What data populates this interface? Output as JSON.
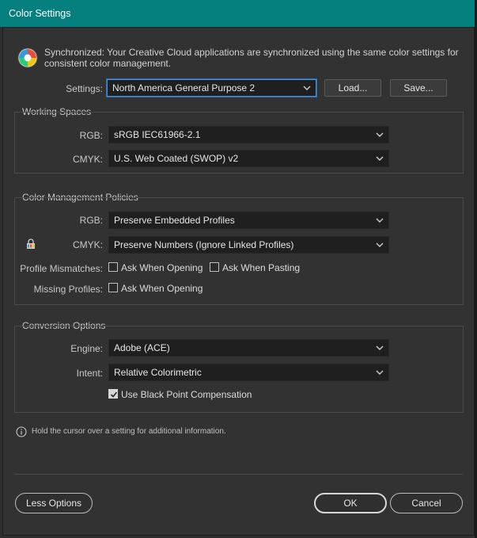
{
  "window": {
    "title": "Color Settings"
  },
  "sync": {
    "icon": "color-wheel-icon",
    "message": "Synchronized: Your Creative Cloud applications are synchronized using the same color settings for consistent color management."
  },
  "settings": {
    "label": "Settings:",
    "value": "North America General Purpose 2",
    "load_label": "Load...",
    "save_label": "Save..."
  },
  "working_spaces": {
    "title": "Working Spaces",
    "rgb_label": "RGB:",
    "rgb_value": "sRGB IEC61966-2.1",
    "cmyk_label": "CMYK:",
    "cmyk_value": "U.S. Web Coated (SWOP) v2"
  },
  "policies": {
    "title": "Color Management Policies",
    "rgb_label": "RGB:",
    "rgb_value": "Preserve Embedded Profiles",
    "cmyk_label": "CMYK:",
    "cmyk_value": "Preserve Numbers (Ignore Linked Profiles)",
    "mismatch_label": "Profile Mismatches:",
    "ask_opening_label": "Ask When Opening",
    "ask_pasting_label": "Ask When Pasting",
    "missing_label": "Missing Profiles:",
    "missing_ask_opening_label": "Ask When Opening",
    "ask_opening_checked": false,
    "ask_pasting_checked": false,
    "missing_ask_opening_checked": false
  },
  "conversion": {
    "title": "Conversion Options",
    "engine_label": "Engine:",
    "engine_value": "Adobe (ACE)",
    "intent_label": "Intent:",
    "intent_value": "Relative Colorimetric",
    "bpc_label": "Use Black Point Compensation",
    "bpc_checked": true
  },
  "info": {
    "message": "Hold the cursor over a setting for additional information."
  },
  "footer": {
    "less_options_label": "Less Options",
    "ok_label": "OK",
    "cancel_label": "Cancel"
  }
}
